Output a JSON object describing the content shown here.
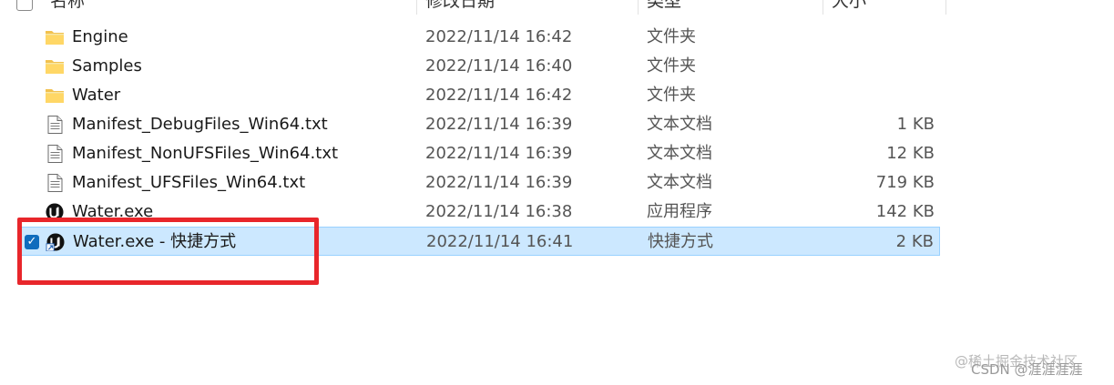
{
  "header": {
    "columns": [
      "名称",
      "修改日期",
      "类型",
      "大小"
    ]
  },
  "rows": [
    {
      "name": "Engine",
      "date": "2022/11/14 16:42",
      "type": "文件夹",
      "size": "",
      "icon": "folder-icon"
    },
    {
      "name": "Samples",
      "date": "2022/11/14 16:40",
      "type": "文件夹",
      "size": "",
      "icon": "folder-icon"
    },
    {
      "name": "Water",
      "date": "2022/11/14 16:42",
      "type": "文件夹",
      "size": "",
      "icon": "folder-icon"
    },
    {
      "name": "Manifest_DebugFiles_Win64.txt",
      "date": "2022/11/14 16:39",
      "type": "文本文档",
      "size": "1 KB",
      "icon": "text-file-icon"
    },
    {
      "name": "Manifest_NonUFSFiles_Win64.txt",
      "date": "2022/11/14 16:39",
      "type": "文本文档",
      "size": "12 KB",
      "icon": "text-file-icon"
    },
    {
      "name": "Manifest_UFSFiles_Win64.txt",
      "date": "2022/11/14 16:39",
      "type": "文本文档",
      "size": "719 KB",
      "icon": "text-file-icon"
    },
    {
      "name": "Water.exe",
      "date": "2022/11/14 16:38",
      "type": "应用程序",
      "size": "142 KB",
      "icon": "unreal-engine-icon"
    },
    {
      "name": "Water.exe - 快捷方式",
      "date": "2022/11/14 16:41",
      "type": "快捷方式",
      "size": "2 KB",
      "icon": "unreal-engine-shortcut-icon",
      "selected": true
    }
  ],
  "colors": {
    "selection_bg": "#cce8ff",
    "selection_border": "#99d1ff",
    "annotation": "#e8262b",
    "check": "#0f6cbd"
  },
  "watermark": {
    "text1": "@稀土掘金技术社区",
    "text2": "CSDN @涯涯涯涯"
  }
}
